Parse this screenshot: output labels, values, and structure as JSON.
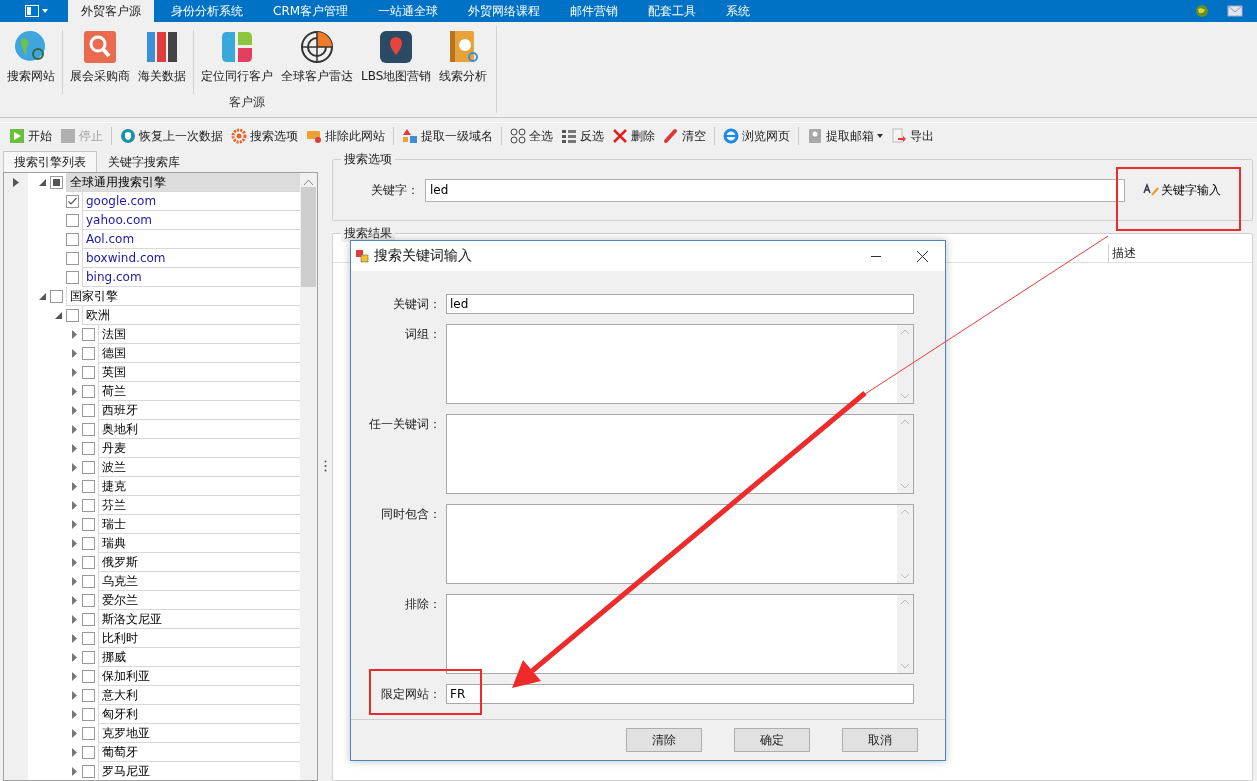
{
  "tabs": [
    {
      "label": "外贸客户源",
      "selected": true
    },
    {
      "label": "身份分析系统",
      "selected": false
    },
    {
      "label": "CRM客户管理",
      "selected": false
    },
    {
      "label": "一站通全球",
      "selected": false
    },
    {
      "label": "外贸网络课程",
      "selected": false
    },
    {
      "label": "邮件营销",
      "selected": false
    },
    {
      "label": "配套工具",
      "selected": false
    },
    {
      "label": "系统",
      "selected": false
    }
  ],
  "ribbon": {
    "group_label": "客户源",
    "items": [
      {
        "kind": "button",
        "label": "搜索网站"
      },
      {
        "kind": "separator"
      },
      {
        "kind": "button",
        "label": "展会采购商"
      },
      {
        "kind": "button",
        "label": "海关数据"
      },
      {
        "kind": "separator"
      },
      {
        "kind": "button",
        "label": "定位同行客户"
      },
      {
        "kind": "button",
        "label": "全球客户雷达"
      },
      {
        "kind": "button",
        "label": "LBS地图营销"
      },
      {
        "kind": "button",
        "label": "线索分析"
      }
    ]
  },
  "toolbar": [
    {
      "kind": "button",
      "label": "开始",
      "disabled": false
    },
    {
      "kind": "button",
      "label": "停止",
      "disabled": true
    },
    {
      "kind": "separator"
    },
    {
      "kind": "button",
      "label": "恢复上一次数据",
      "disabled": false
    },
    {
      "kind": "button",
      "label": "搜索选项",
      "disabled": false
    },
    {
      "kind": "button",
      "label": "排除此网站",
      "disabled": false
    },
    {
      "kind": "separator"
    },
    {
      "kind": "button",
      "label": "提取一级域名",
      "disabled": false
    },
    {
      "kind": "separator"
    },
    {
      "kind": "button",
      "label": "全选",
      "disabled": false
    },
    {
      "kind": "button",
      "label": "反选",
      "disabled": false
    },
    {
      "kind": "button",
      "label": "删除",
      "disabled": false
    },
    {
      "kind": "button",
      "label": "清空",
      "disabled": false
    },
    {
      "kind": "separator"
    },
    {
      "kind": "button",
      "label": "浏览网页",
      "disabled": false
    },
    {
      "kind": "separator"
    },
    {
      "kind": "button",
      "label": "提取邮箱",
      "disabled": false,
      "dropdown": true
    },
    {
      "kind": "button",
      "label": "导出",
      "disabled": false
    }
  ],
  "left_panel": {
    "tabs": [
      {
        "label": "搜索引擎列表",
        "selected": true
      },
      {
        "label": "关键字搜索库",
        "selected": false
      }
    ],
    "tree": [
      {
        "label": "全球通用搜索引擎",
        "kind": "group",
        "expanded": true,
        "checked": false,
        "partial": true,
        "selected": true,
        "children": [
          {
            "label": "google.com",
            "kind": "site",
            "checked": true,
            "partial": false,
            "selected": false
          },
          {
            "label": "yahoo.com",
            "kind": "site",
            "checked": false,
            "partial": false,
            "selected": false
          },
          {
            "label": "Aol.com",
            "kind": "site",
            "checked": false,
            "partial": false,
            "selected": false
          },
          {
            "label": "boxwind.com",
            "kind": "site",
            "checked": false,
            "partial": false,
            "selected": false
          },
          {
            "label": "bing.com",
            "kind": "site",
            "checked": false,
            "partial": false,
            "selected": false
          }
        ]
      },
      {
        "label": "国家引擎",
        "kind": "group",
        "expanded": true,
        "checked": false,
        "partial": false,
        "selected": false,
        "children": [
          {
            "label": "欧洲",
            "kind": "group",
            "expanded": true,
            "checked": false,
            "partial": false,
            "selected": false,
            "children": [
              {
                "label": "法国",
                "kind": "group",
                "expanded": false,
                "checked": false,
                "partial": false,
                "selected": false
              },
              {
                "label": "德国",
                "kind": "group",
                "expanded": false,
                "checked": false,
                "partial": false,
                "selected": false
              },
              {
                "label": "英国",
                "kind": "group",
                "expanded": false,
                "checked": false,
                "partial": false,
                "selected": false
              },
              {
                "label": "荷兰",
                "kind": "group",
                "expanded": false,
                "checked": false,
                "partial": false,
                "selected": false
              },
              {
                "label": "西班牙",
                "kind": "group",
                "expanded": false,
                "checked": false,
                "partial": false,
                "selected": false
              },
              {
                "label": "奥地利",
                "kind": "group",
                "expanded": false,
                "checked": false,
                "partial": false,
                "selected": false
              },
              {
                "label": "丹麦",
                "kind": "group",
                "expanded": false,
                "checked": false,
                "partial": false,
                "selected": false
              },
              {
                "label": "波兰",
                "kind": "group",
                "expanded": false,
                "checked": false,
                "partial": false,
                "selected": false
              },
              {
                "label": "捷克",
                "kind": "group",
                "expanded": false,
                "checked": false,
                "partial": false,
                "selected": false
              },
              {
                "label": "芬兰",
                "kind": "group",
                "expanded": false,
                "checked": false,
                "partial": false,
                "selected": false
              },
              {
                "label": "瑞士",
                "kind": "group",
                "expanded": false,
                "checked": false,
                "partial": false,
                "selected": false
              },
              {
                "label": "瑞典",
                "kind": "group",
                "expanded": false,
                "checked": false,
                "partial": false,
                "selected": false
              },
              {
                "label": "俄罗斯",
                "kind": "group",
                "expanded": false,
                "checked": false,
                "partial": false,
                "selected": false
              },
              {
                "label": "乌克兰",
                "kind": "group",
                "expanded": false,
                "checked": false,
                "partial": false,
                "selected": false
              },
              {
                "label": "爱尔兰",
                "kind": "group",
                "expanded": false,
                "checked": false,
                "partial": false,
                "selected": false
              },
              {
                "label": "斯洛文尼亚",
                "kind": "group",
                "expanded": false,
                "checked": false,
                "partial": false,
                "selected": false
              },
              {
                "label": "比利时",
                "kind": "group",
                "expanded": false,
                "checked": false,
                "partial": false,
                "selected": false
              },
              {
                "label": "挪威",
                "kind": "group",
                "expanded": false,
                "checked": false,
                "partial": false,
                "selected": false
              },
              {
                "label": "保加利亚",
                "kind": "group",
                "expanded": false,
                "checked": false,
                "partial": false,
                "selected": false
              },
              {
                "label": "意大利",
                "kind": "group",
                "expanded": false,
                "checked": false,
                "partial": false,
                "selected": false
              },
              {
                "label": "匈牙利",
                "kind": "group",
                "expanded": false,
                "checked": false,
                "partial": false,
                "selected": false
              },
              {
                "label": "克罗地亚",
                "kind": "group",
                "expanded": false,
                "checked": false,
                "partial": false,
                "selected": false
              },
              {
                "label": "葡萄牙",
                "kind": "group",
                "expanded": false,
                "checked": false,
                "partial": false,
                "selected": false
              },
              {
                "label": "罗马尼亚",
                "kind": "group",
                "expanded": false,
                "checked": false,
                "partial": false,
                "selected": false
              }
            ]
          }
        ]
      }
    ]
  },
  "search_options": {
    "title": "搜索选项",
    "keyword_label": "关键字：",
    "keyword_value": "led",
    "keyword_button": "关键字输入"
  },
  "search_results": {
    "title": "搜索结果",
    "columns": [
      "描述"
    ]
  },
  "dialog": {
    "title": "搜索关键词输入",
    "fields": [
      {
        "label": "关键词：",
        "kind": "line",
        "value": "led"
      },
      {
        "label": "词组：",
        "kind": "area"
      },
      {
        "label": "任一关键词：",
        "kind": "area"
      },
      {
        "label": "同时包含：",
        "kind": "area"
      },
      {
        "label": "排除：",
        "kind": "area"
      },
      {
        "label": "限定网站：",
        "kind": "line",
        "value": "FR"
      }
    ],
    "buttons": [
      "清除",
      "确定",
      "取消"
    ]
  }
}
